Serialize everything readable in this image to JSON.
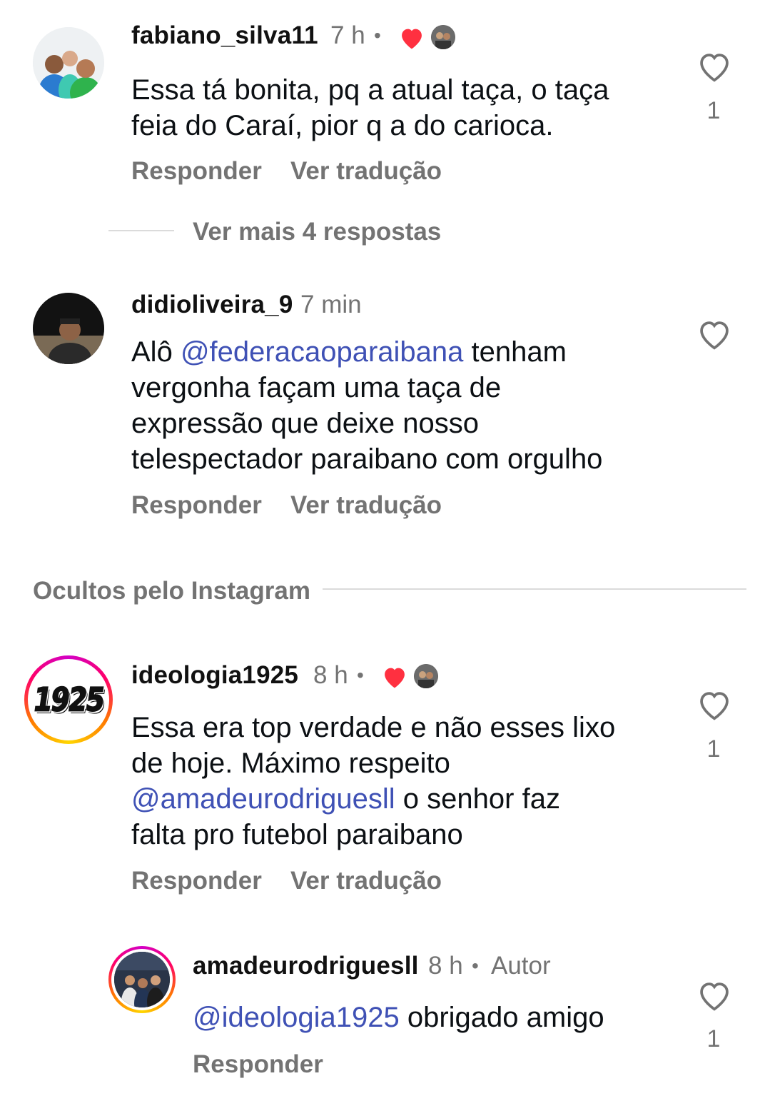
{
  "comments": [
    {
      "username": "fabiano_silva11",
      "time": "7 h",
      "text_lines": [
        "Essa tá bonita, pq a atual taça, o taça",
        "feia do Caraí, pior q a do carioca."
      ],
      "like_count": "1",
      "reply_label": "Responder",
      "translate_label": "Ver tradução"
    },
    {
      "username": "didioliveira_9",
      "time": "7 min",
      "mention": "@federacaoparaibana",
      "text_line1_rest": " tenham",
      "text_lines": [
        "vergonha façam uma taça de",
        "expressão que deixe nosso",
        "telespectador paraibano com orgulho"
      ],
      "prefix": "Alô ",
      "reply_label": "Responder",
      "translate_label": "Ver tradução"
    },
    {
      "username": "ideologia1925",
      "time": "8 h",
      "avatar_text": "1925",
      "text_lines": [
        "Essa era top verdade e não esses lixo",
        "de hoje. Máximo respeito"
      ],
      "mention": "@amadeurodriguesll",
      "mention_rest": " o senhor faz",
      "last_line": "falta pro futebol paraibano",
      "like_count": "1",
      "reply_label": "Responder",
      "translate_label": "Ver tradução"
    },
    {
      "username": "amadeurodriguesll",
      "time": "8 h",
      "author_tag": "Autor",
      "mention": "@ideologia1925",
      "text_rest": " obrigado amigo",
      "like_count": "1",
      "reply_label": "Responder"
    }
  ],
  "more_replies_label": "Ver mais 4 respostas",
  "hidden_section_label": "Ocultos pelo Instagram",
  "colors": {
    "like_red": "#ff3040",
    "mention": "#3f51b5",
    "muted": "#737373"
  }
}
